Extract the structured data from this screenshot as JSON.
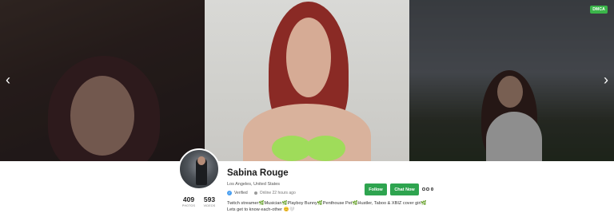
{
  "banner": {
    "dmca_badge": "DMCA",
    "prev_arrow": "‹",
    "next_arrow": "›"
  },
  "profile": {
    "name": "Sabina Rouge",
    "location": "Los Angeles, United States",
    "verified_label": "Verified",
    "online_status": "Online 22 hours ago",
    "stats": [
      {
        "value": "409",
        "label": "PHOTOS"
      },
      {
        "value": "593",
        "label": "VIDEOS"
      }
    ],
    "bio_line1": "Twitch streamer🌿Musician🌿Playboy Bunny🌿Penthouse Pet🌿Hustler, Taboo & XBIZ cover girl🌿",
    "bio_line2": "Lets get to know each-other 😊🤍"
  },
  "actions": {
    "follow_label": "Follow",
    "chat_label": "Chat Now"
  },
  "colors": {
    "accent_green": "#2ea44f",
    "verified_blue": "#4a9ff0"
  },
  "icons": [
    "chevron-left-icon",
    "chevron-right-icon",
    "verified-check-icon",
    "online-dot-icon",
    "more-options-icon"
  ]
}
